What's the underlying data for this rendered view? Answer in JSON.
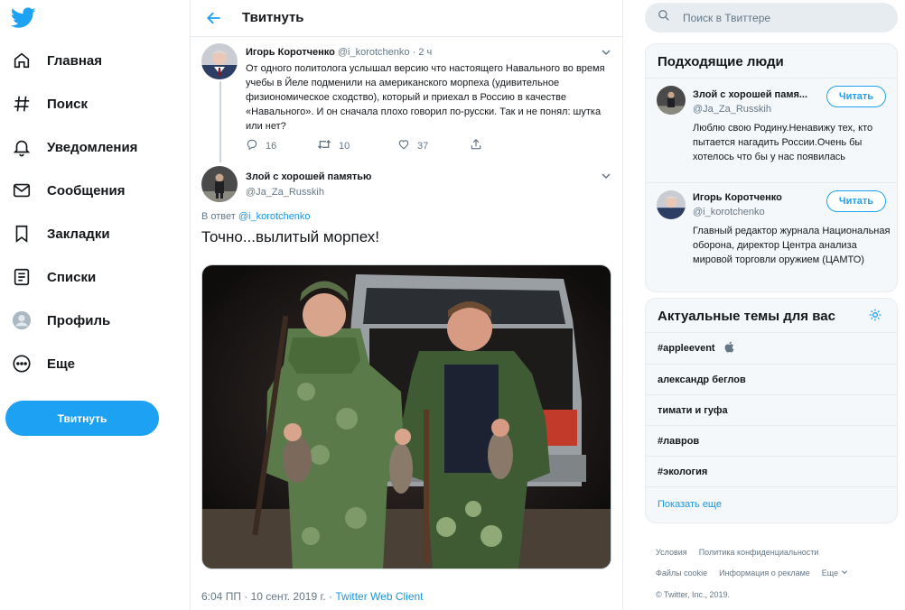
{
  "nav": {
    "items": [
      {
        "label": "Главная",
        "icon": "home-icon"
      },
      {
        "label": "Поиск",
        "icon": "hashtag-icon"
      },
      {
        "label": "Уведомления",
        "icon": "bell-icon"
      },
      {
        "label": "Сообщения",
        "icon": "envelope-icon"
      },
      {
        "label": "Закладки",
        "icon": "bookmark-icon"
      },
      {
        "label": "Списки",
        "icon": "list-icon"
      },
      {
        "label": "Профиль",
        "icon": "profile-icon"
      },
      {
        "label": "Еще",
        "icon": "more-icon"
      }
    ],
    "tweet_button": "Твитнуть"
  },
  "header": {
    "title": "Твитнуть"
  },
  "tweet1": {
    "name": "Игорь Коротченко",
    "handle": "@i_korotchenko",
    "separator": "·",
    "time": "2 ч",
    "text": "От одного политолога услышал версию что настоящего Навального во время учебы в Йеле подменили на американского морпеха (удивительное физиономическое сходство), который и приехал в Россию в качестве «Навального». И он сначала плохо говорил по-русски. Так и не понял: шутка или нет?",
    "replies": "16",
    "retweets": "10",
    "likes": "37"
  },
  "tweet2": {
    "name": "Злой с хорошей памятью",
    "handle": "@Ja_Za_Russkih",
    "reply_prefix": "В ответ",
    "reply_to": "@i_korotchenko",
    "text": "Точно...вылитый морпех!",
    "timestamp": "6:04 ПП · 10 сент. 2019 г. ·",
    "client": "Twitter Web Client"
  },
  "search": {
    "placeholder": "Поиск в Твиттере"
  },
  "who_to_follow": {
    "title": "Подходящие люди",
    "follow_label": "Читать",
    "users": [
      {
        "name": "Злой с хорошей памя...",
        "handle": "@Ja_Za_Russkih",
        "bio": "Люблю свою Родину.Ненавижу тех, кто пытается нагадить России.Очень бы хотелось что бы у нас появилась"
      },
      {
        "name": "Игорь Коротченко",
        "handle": "@i_korotchenko",
        "bio": "Главный редактор журнала Национальная оборона, директор Центра анализа мировой торговли оружием (ЦАМТО)"
      }
    ]
  },
  "trends": {
    "title": "Актуальные темы для вас",
    "items": [
      "#appleevent",
      "александр беглов",
      "тимати и гуфа",
      "#лавров",
      "#экология"
    ],
    "show_more": "Показать еще"
  },
  "footer": {
    "links": [
      "Условия",
      "Политика конфиденциальности",
      "Файлы cookie",
      "Информация о рекламе",
      "Еще"
    ],
    "copyright": "© Twitter, Inc., 2019."
  },
  "colors": {
    "accent": "#1da1f2",
    "link": "#1b95e0",
    "muted": "#657786",
    "border": "#e6ecf0"
  }
}
